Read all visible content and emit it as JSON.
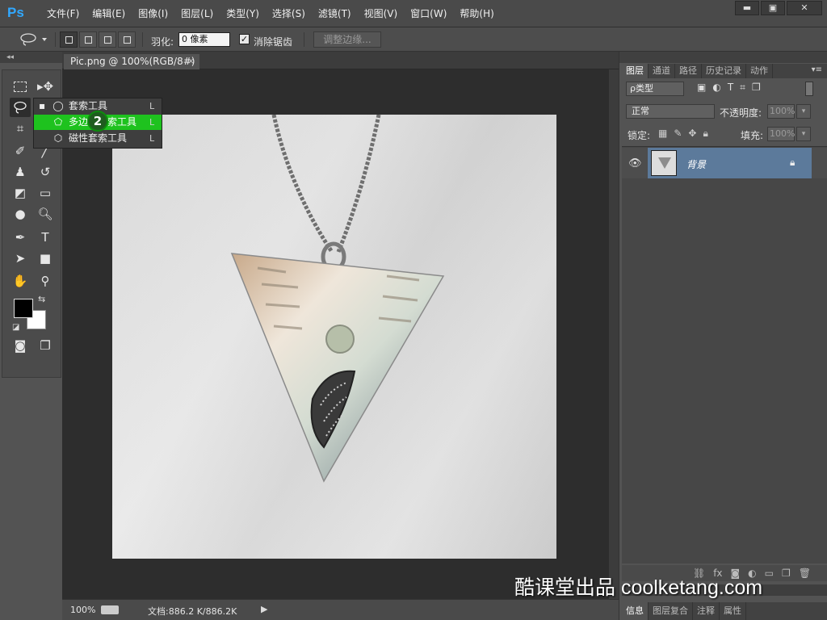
{
  "app": {
    "logo": "Ps"
  },
  "menu": [
    "文件(F)",
    "编辑(E)",
    "图像(I)",
    "图层(L)",
    "类型(Y)",
    "选择(S)",
    "滤镜(T)",
    "视图(V)",
    "窗口(W)",
    "帮助(H)"
  ],
  "window_controls": {
    "minimize": "▬",
    "restore": "▣",
    "close": "✕"
  },
  "options": {
    "tool_icon": "lasso-icon",
    "feather_label": "羽化:",
    "feather_value": "0 像素",
    "antialias_label": "消除锯齿",
    "antialias_checked": "✓",
    "refine_button": "调整边缘..."
  },
  "flyout": {
    "items": [
      {
        "bullet": "▪",
        "icon": "◯",
        "label": "套索工具",
        "key": "L"
      },
      {
        "bullet": "",
        "icon": "⬠",
        "label": "多边形套索工具",
        "key": "L"
      },
      {
        "bullet": "",
        "icon": "⬡",
        "label": "磁性套索工具",
        "key": "L"
      }
    ],
    "highlighted_index": 1,
    "highlight_color": "#1ec21e"
  },
  "step_badge": "2",
  "document": {
    "tab_title": "Pic.png @ 100%(RGB/8#)",
    "tab_close": "×",
    "zoom": "100%",
    "doc_size": "文档:886.2 K/886.2K",
    "status_arrow": "▶"
  },
  "panels": {
    "tabs": [
      "图层",
      "通道",
      "路径",
      "历史记录",
      "动作"
    ],
    "active_tab": "图层",
    "filter_kind": "ρ类型",
    "blend_mode": "正常",
    "opacity_label": "不透明度:",
    "opacity_value": "100%",
    "lock_label": "锁定:",
    "fill_label": "填充:",
    "fill_value": "100%",
    "layers": [
      {
        "name": "背景",
        "visible": true,
        "locked": true
      }
    ],
    "bottom_tabs": [
      "信息",
      "图层复合",
      "注释",
      "属性"
    ],
    "selected_color": "#5c7a9b"
  },
  "watermark": "酷课堂出品 coolketang.com"
}
